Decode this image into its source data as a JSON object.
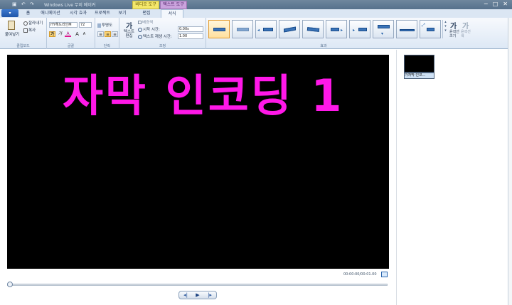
{
  "titlebar": {
    "title": "Windows Live 무비 메이커",
    "contextual_video": "비디오 도구",
    "contextual_text": "텍스트 도구",
    "window_buttons": [
      "─",
      "□",
      "✕"
    ]
  },
  "tabs": {
    "app_button": "▾",
    "items": [
      "홈",
      "애니메이션",
      "시각 효과",
      "프로젝트",
      "보기",
      "편집",
      "서식"
    ],
    "active": "서식"
  },
  "ribbon": {
    "clipboard": {
      "paste": "붙여넣기",
      "cut": "잘라내기",
      "copy": "복사",
      "label": "클립보드"
    },
    "font": {
      "family": "HY헤드라인M",
      "size": "72",
      "bold": "가",
      "italic": "가",
      "color": "A",
      "grow": "A",
      "shrink": "A",
      "label": "글꼴"
    },
    "paragraph": {
      "transparency": "투명도",
      "label": "단락"
    },
    "adjust": {
      "edit_text": "텍스트 편집",
      "background": "배경색",
      "start_time_label": "시작 시간:",
      "start_time": "0.00s",
      "duration_label": "텍스트 재생 시간:",
      "duration": "1.00",
      "label": "조정"
    },
    "effects": {
      "label": "효과",
      "outline_size": "윤곽선 크기",
      "outline_color": "윤곽선 색"
    }
  },
  "preview": {
    "caption_text": "자막 인코딩 1",
    "timecode": "00:00:00/00:01.00"
  },
  "storyboard": {
    "clip_caption": "가자막 인코..."
  },
  "playback": {
    "prev": "◂|",
    "play": "▶",
    "next": "|▸"
  },
  "colors": {
    "caption": "#ff18e8",
    "accent": "#1f55a9"
  }
}
